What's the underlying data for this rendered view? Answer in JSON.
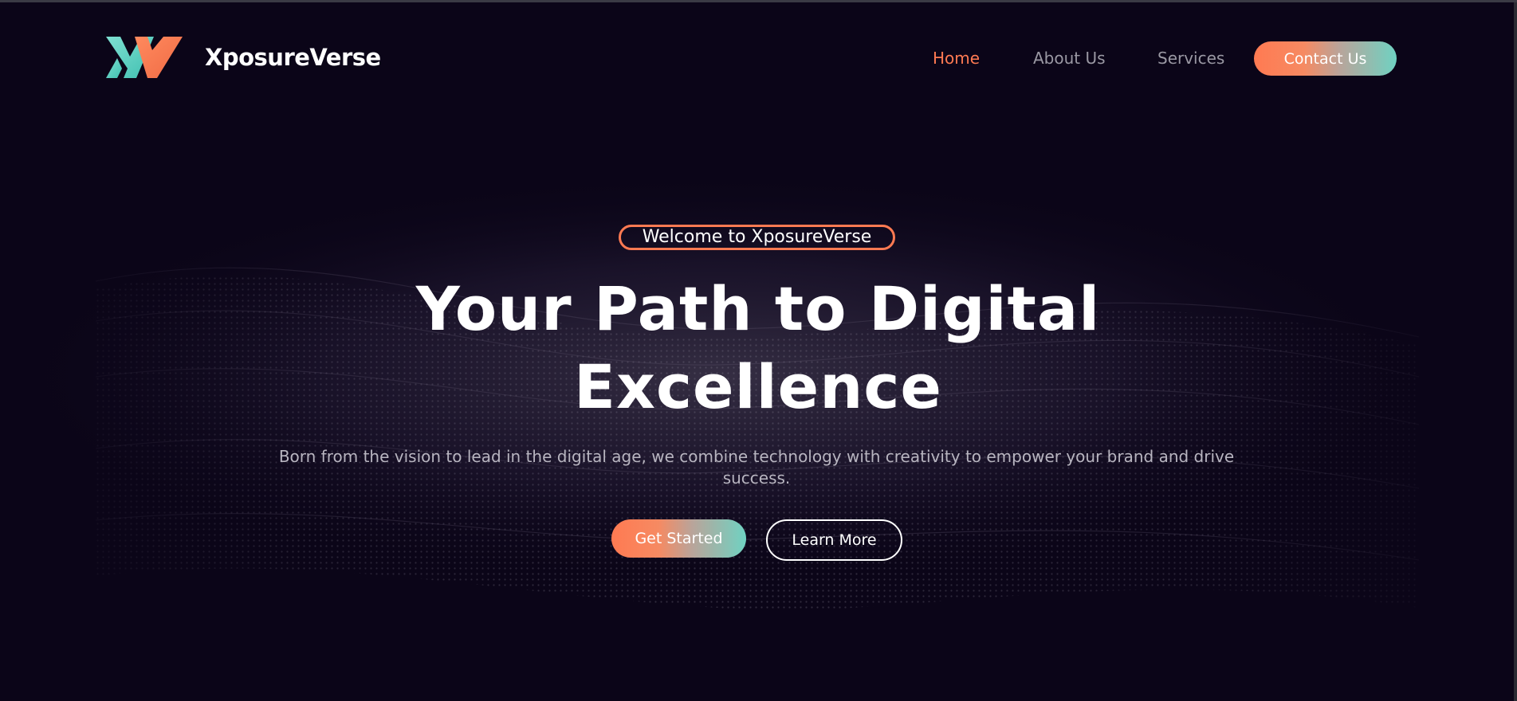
{
  "brand": {
    "name": "XposureVerse",
    "logo_icon": "xv-logo-icon",
    "colors": {
      "accent_orange": "#ff7a52",
      "accent_teal": "#5ed3c3",
      "background": "#0b0518"
    }
  },
  "nav": {
    "items": [
      {
        "label": "Home",
        "active": true
      },
      {
        "label": "About Us",
        "active": false
      },
      {
        "label": "Services",
        "active": false
      }
    ],
    "cta_label": "Contact Us"
  },
  "hero": {
    "badge": "Welcome to XposureVerse",
    "headline_line1": "Your Path to Digital",
    "headline_line2": "Excellence",
    "subtext_line1": "Born from the vision to lead in the digital age, we combine technology with creativity to empower your brand and drive",
    "subtext_line2": "success.",
    "primary_button": "Get Started",
    "secondary_button": "Learn More"
  }
}
